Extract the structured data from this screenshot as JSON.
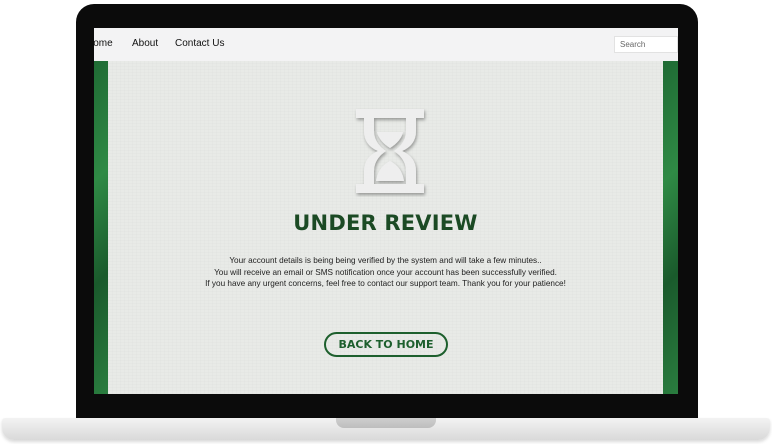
{
  "nav": {
    "links": [
      "Home",
      "About",
      "Contact Us"
    ],
    "search_placeholder": "Search"
  },
  "main": {
    "title": "UNDER REVIEW",
    "message_lines": [
      "Your account details is being being verified by the system and will take a few minutes..",
      "You will receive an email or SMS notification once your account has been successfully verified.",
      "If you have any urgent concerns, feel free to contact our support team. Thank you for your patience!"
    ],
    "button_label": "BACK TO HOME",
    "icon": "hourglass-icon"
  },
  "colors": {
    "accent": "#1d5f2d",
    "side_panels": "#2a7d3f",
    "background": "#e8eae7",
    "bezel": "#0b0b0b"
  }
}
